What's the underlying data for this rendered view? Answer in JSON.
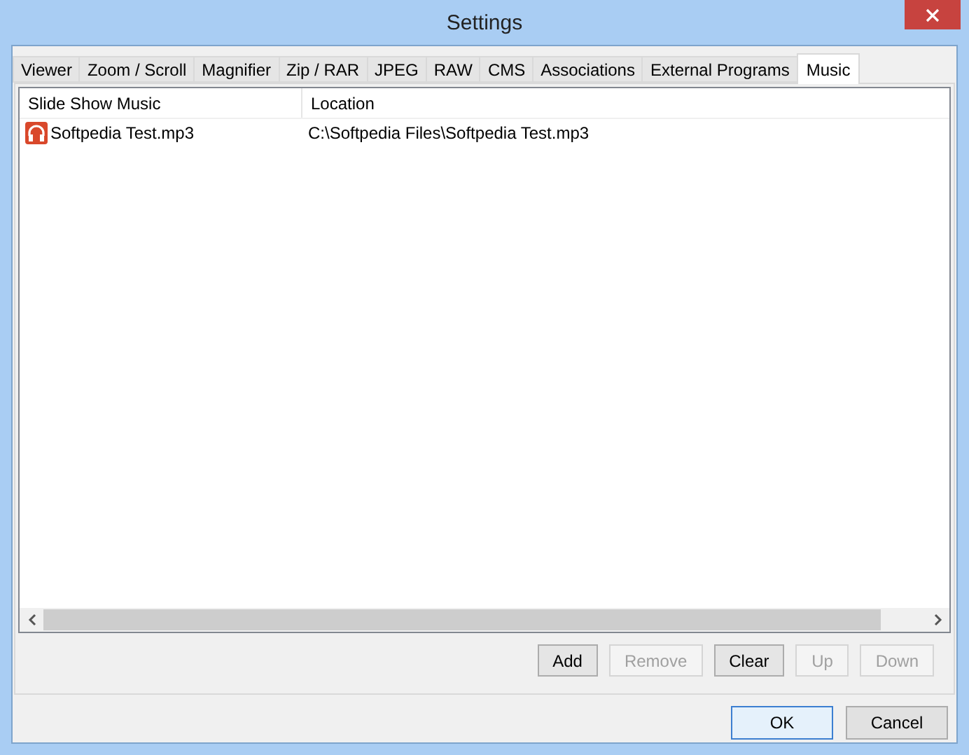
{
  "window": {
    "title": "Settings"
  },
  "tabs": [
    {
      "label": "Viewer",
      "selected": false
    },
    {
      "label": "Zoom / Scroll",
      "selected": false
    },
    {
      "label": "Magnifier",
      "selected": false
    },
    {
      "label": "Zip / RAR",
      "selected": false
    },
    {
      "label": "JPEG",
      "selected": false
    },
    {
      "label": "RAW",
      "selected": false
    },
    {
      "label": "CMS",
      "selected": false
    },
    {
      "label": "Associations",
      "selected": false
    },
    {
      "label": "External Programs",
      "selected": false
    },
    {
      "label": "Music",
      "selected": true
    }
  ],
  "table": {
    "columns": [
      "Slide Show Music",
      "Location"
    ],
    "rows": [
      {
        "cells": [
          "Softpedia Test.mp3",
          "C:\\Softpedia Files\\Softpedia Test.mp3"
        ]
      }
    ]
  },
  "list_buttons": [
    {
      "label": "Add",
      "disabled": false
    },
    {
      "label": "Remove",
      "disabled": true
    },
    {
      "label": "Clear",
      "disabled": false
    },
    {
      "label": "Up",
      "disabled": true
    },
    {
      "label": "Down",
      "disabled": true
    }
  ],
  "dialog_buttons": [
    {
      "label": "OK",
      "default": true
    },
    {
      "label": "Cancel",
      "default": false
    }
  ]
}
